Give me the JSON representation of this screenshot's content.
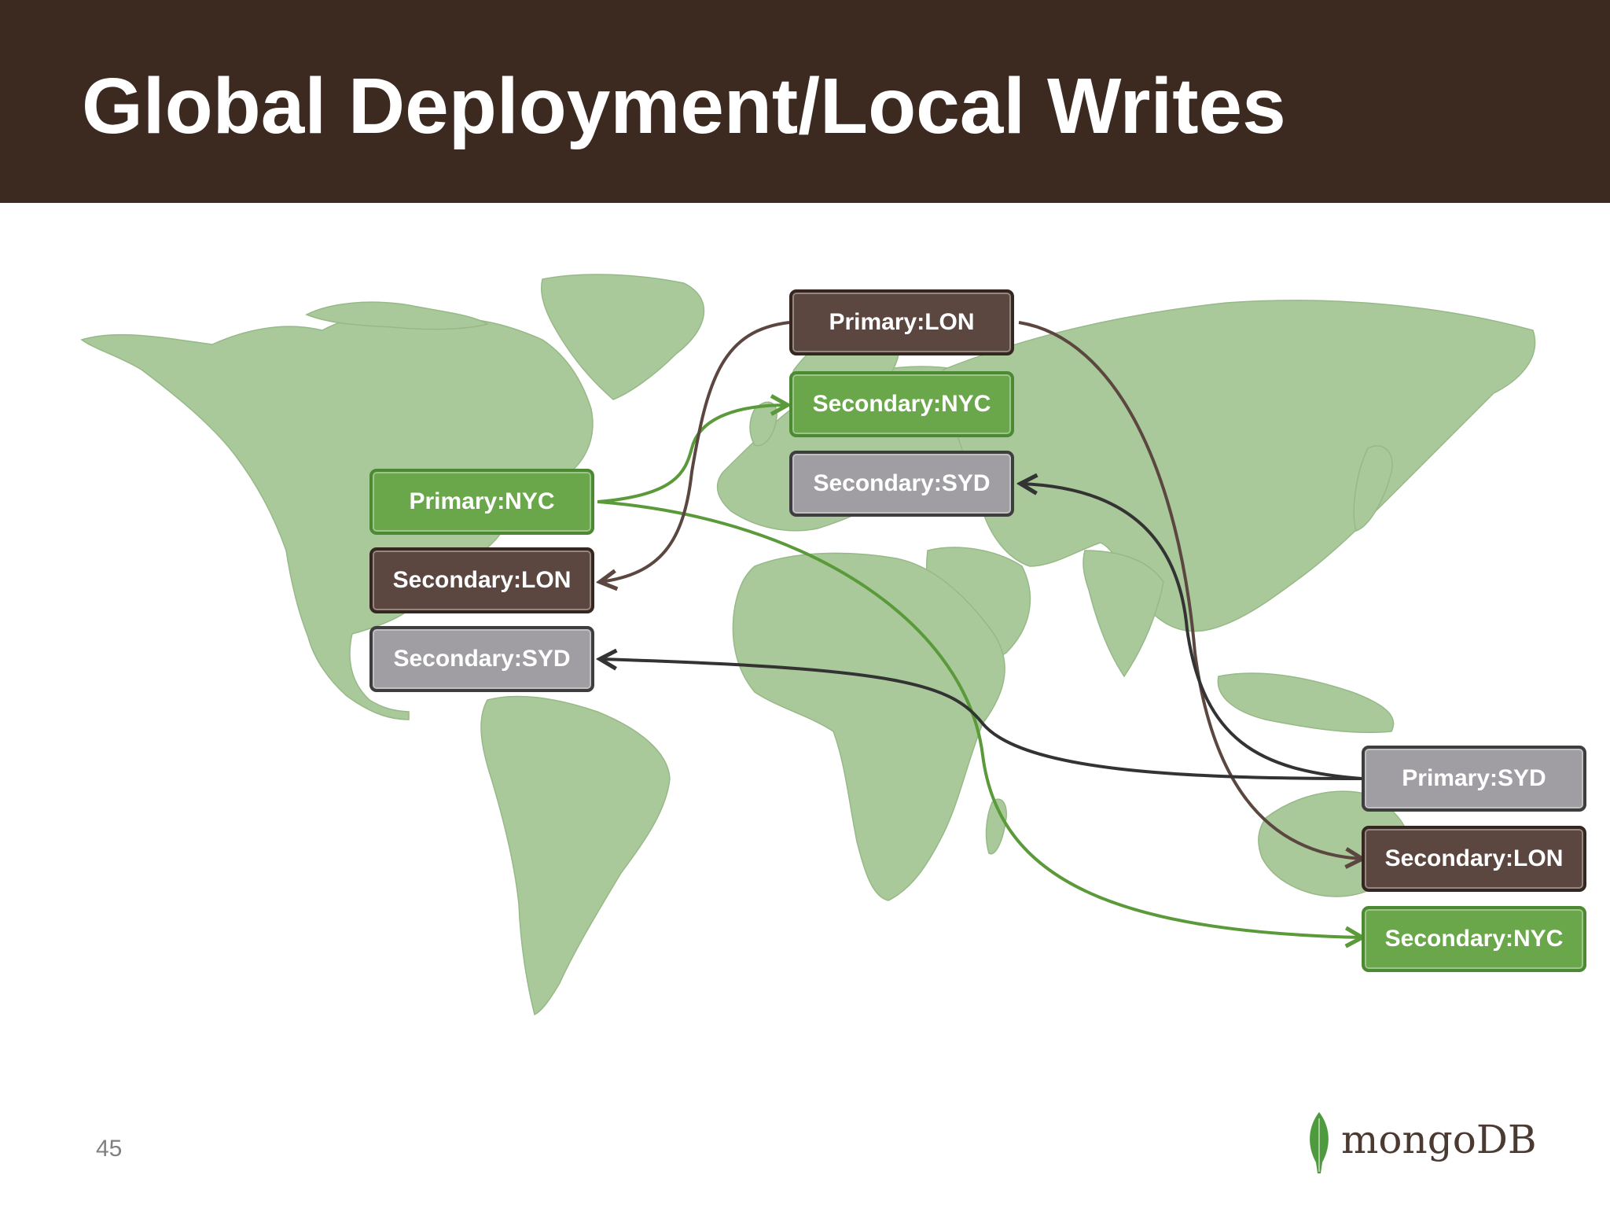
{
  "slide": {
    "title": "Global Deployment/Local Writes",
    "page_number": "45"
  },
  "logo": {
    "text": "mongoDB",
    "icon": "leaf-icon"
  },
  "colors": {
    "header_bg": "#3c2a21",
    "land": "#a9c99a",
    "nyc": "#6aa64a",
    "lon": "#5b4740",
    "syd": "#a09ea3",
    "arrow_nyc": "#5a9a3a",
    "arrow_lon": "#5b4740",
    "arrow_syd": "#333333"
  },
  "nodes": {
    "lon_group": {
      "primary": "Primary:LON",
      "secondary_nyc": "Secondary:NYC",
      "secondary_syd": "Secondary:SYD"
    },
    "nyc_group": {
      "primary": "Primary:NYC",
      "secondary_lon": "Secondary:LON",
      "secondary_syd": "Secondary:SYD"
    },
    "syd_group": {
      "primary": "Primary:SYD",
      "secondary_lon": "Secondary:LON",
      "secondary_nyc": "Secondary:NYC"
    }
  }
}
